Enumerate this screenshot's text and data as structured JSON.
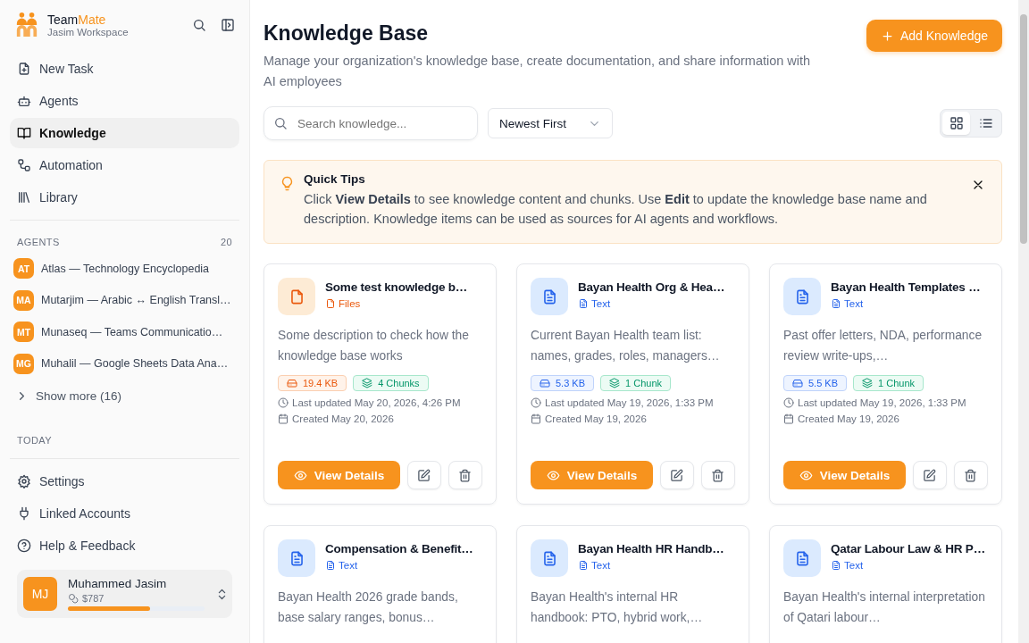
{
  "brand": {
    "name_start": "Team",
    "name_end": "Mate",
    "workspace": "Jasim Workspace"
  },
  "nav": [
    {
      "label": "New Task",
      "selected": false
    },
    {
      "label": "Agents",
      "selected": false
    },
    {
      "label": "Knowledge",
      "selected": true
    },
    {
      "label": "Automation",
      "selected": false
    },
    {
      "label": "Library",
      "selected": false
    }
  ],
  "agents": {
    "title": "AGENTS",
    "count": "20",
    "show_more": "Show more (16)",
    "items": [
      {
        "initials": "AT",
        "name": "Atlas — Technology Encyclopedia"
      },
      {
        "initials": "MA",
        "name": "Mutarjim — Arabic ↔ English Transl…"
      },
      {
        "initials": "MT",
        "name": "Munaseq — Teams Communicatio…"
      },
      {
        "initials": "MG",
        "name": "Muhalil — Google Sheets Data Ana…"
      }
    ]
  },
  "today_label": "TODAY",
  "footer_nav": [
    {
      "label": "Settings"
    },
    {
      "label": "Linked Accounts"
    },
    {
      "label": "Help & Feedback"
    }
  ],
  "user": {
    "initials": "MJ",
    "name": "Muhammed Jasim",
    "credits": "$787",
    "level": 0.6
  },
  "header": {
    "title": "Knowledge Base",
    "subtitle": "Manage your organization's knowledge base, create documentation, and share information with AI employees",
    "add_button": "Add Knowledge"
  },
  "search": {
    "placeholder": "Search knowledge..."
  },
  "sort": {
    "value": "Newest First"
  },
  "view_toggle": [
    {
      "selected": true
    },
    {
      "selected": false
    }
  ],
  "tips": {
    "title": "Quick Tips",
    "text": "Click **View Details** to see knowledge content and chunks. Use **Edit** to update the knowledge base name and description. Knowledge items can be used as sources for AI agents and workflows."
  },
  "cards": [
    {
      "kind": "files",
      "title": "Some test knowledge b…",
      "type_label": "Files",
      "description": "Some description to check how the knowledge base works",
      "size": "19.4 KB",
      "chunks": "4 Chunks",
      "updated": "Last updated May 20, 2026, 4:26 PM",
      "created": "Created May 20, 2026",
      "view_button": "View Details"
    },
    {
      "kind": "text",
      "title": "Bayan Health Org & Hea…",
      "type_label": "Text",
      "description": "Current Bayan Health team list: names, grades, roles, managers…",
      "size": "5.3 KB",
      "chunks": "1 Chunk",
      "updated": "Last updated May 19, 2026, 1:33 PM",
      "created": "Created May 19, 2026",
      "view_button": "View Details"
    },
    {
      "kind": "text",
      "title": "Bayan Health Templates …",
      "type_label": "Text",
      "description": "Past offer letters, NDA, performance review write-ups,…",
      "size": "5.5 KB",
      "chunks": "1 Chunk",
      "updated": "Last updated May 19, 2026, 1:33 PM",
      "created": "Created May 19, 2026",
      "view_button": "View Details"
    },
    {
      "kind": "text",
      "title": "Compensation & Benefit…",
      "type_label": "Text",
      "description": "Bayan Health 2026 grade bands, base salary ranges, bonus…"
    },
    {
      "kind": "text",
      "title": "Bayan Health HR Handb…",
      "type_label": "Text",
      "description": "Bayan Health's internal HR handbook: PTO, hybrid work,…"
    },
    {
      "kind": "text",
      "title": "Qatar Labour Law & HR P…",
      "type_label": "Text",
      "description": "Bayan Health's internal interpretation of Qatari labour…"
    }
  ]
}
